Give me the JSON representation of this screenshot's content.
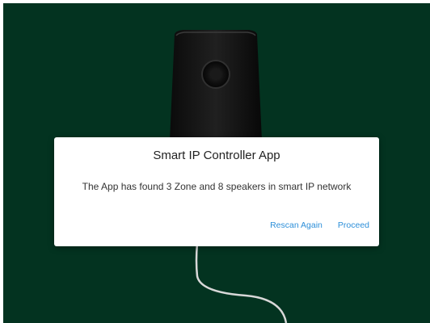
{
  "dialog": {
    "title": "Smart IP Controller App",
    "message": "The App has found 3 Zone and 8 speakers in smart IP network",
    "rescan_label": "Rescan Again",
    "proceed_label": "Proceed"
  },
  "colors": {
    "background": "#033320",
    "accent": "#2d8fd9"
  },
  "icons": [
    "speaker-illustration",
    "cable-illustration"
  ]
}
